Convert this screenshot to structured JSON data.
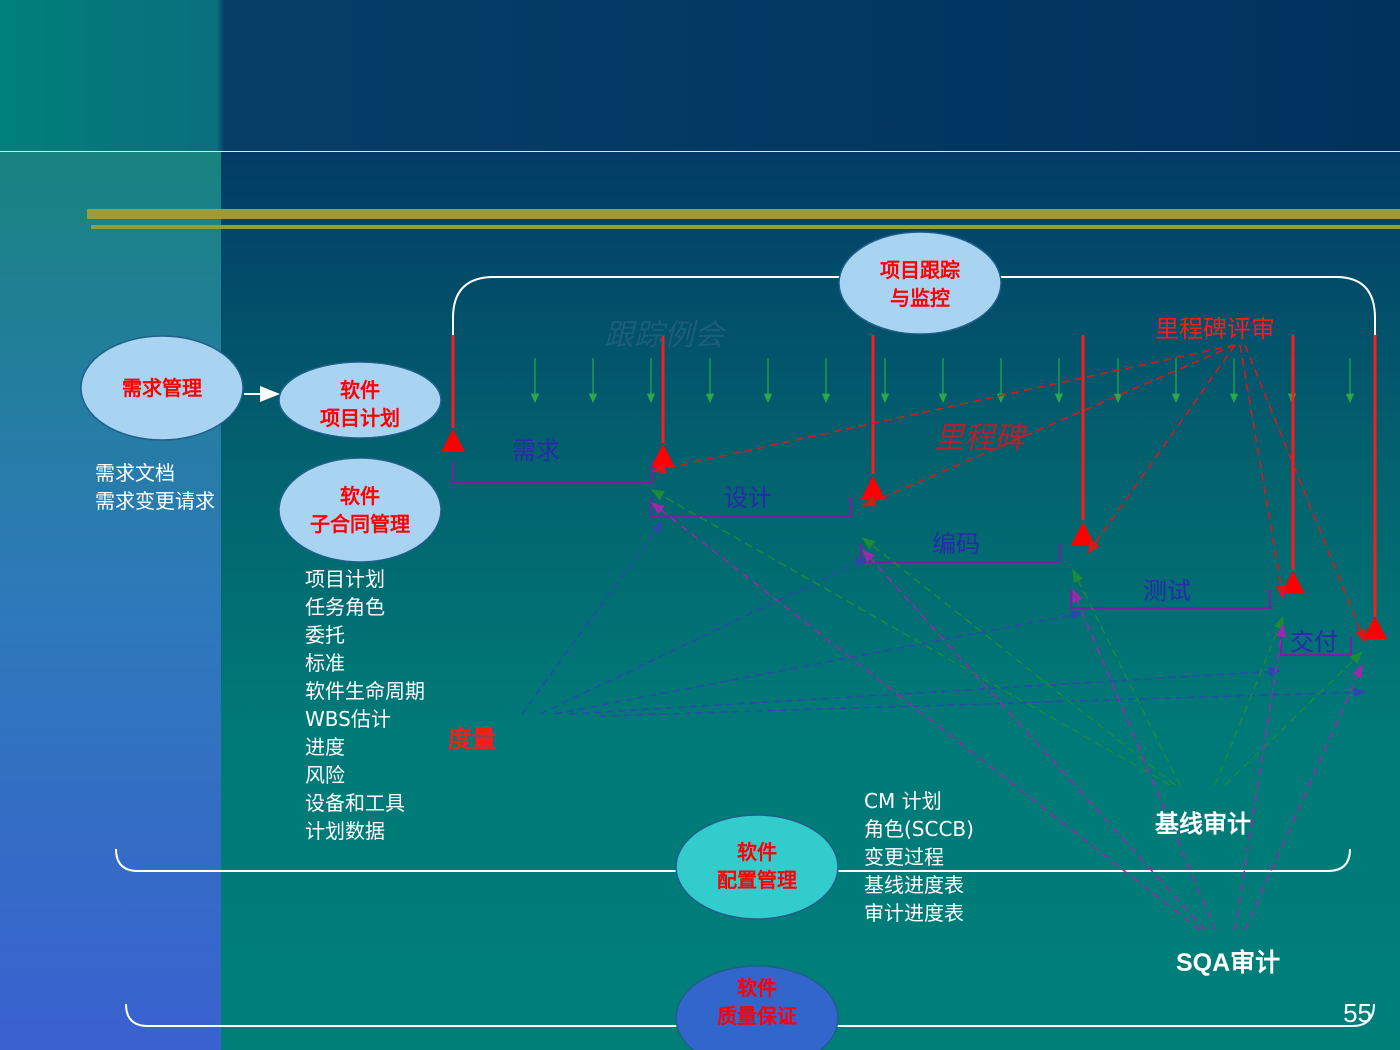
{
  "slide": {
    "page_number": "55",
    "colors": {
      "accent_red": "#ff0000",
      "node_fill": "#a8d4f2",
      "cm_node_fill": "#33cccc",
      "sqa_node_fill": "#3366cc",
      "phase_bracket": "#7a1fa3",
      "olive_bar": "#9a9b3a"
    }
  },
  "nodes": {
    "requirements": "需求管理",
    "plan_line1": "软件",
    "plan_line2": "项目计划",
    "subcontract_line1": "软件",
    "subcontract_line2": "子合同管理",
    "tracking_line1": "项目跟踪",
    "tracking_line2": "与监控",
    "cm_line1": "软件",
    "cm_line2": "配置管理",
    "qa_line1": "软件",
    "qa_line2": "质量保证"
  },
  "requirements_outputs": [
    "需求文档",
    "需求变更请求"
  ],
  "plan_items": [
    "项目计划",
    "任务角色",
    "委托",
    "标准",
    "软件生命周期",
    "WBS估计",
    "进度",
    "风险",
    "设备和工具",
    "计划数据"
  ],
  "cm_items": [
    "CM 计划",
    "角色(SCCB)",
    "变更过程",
    "基线进度表",
    "审计进度表"
  ],
  "phases": [
    "需求",
    "设计",
    "编码",
    "测试",
    "交付"
  ],
  "labels": {
    "tracking_meeting": "跟踪例会",
    "milestone": "里程碑",
    "milestone_review": "里程碑评审",
    "metrics": "度量",
    "baseline_audit": "基线审计",
    "sqa_audit": "SQA审计"
  }
}
